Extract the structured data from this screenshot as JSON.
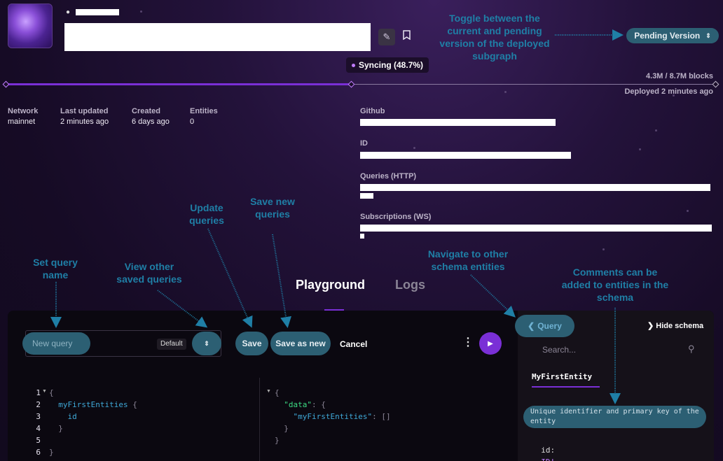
{
  "header": {
    "sync_status": "Syncing (48.7%)",
    "blocks": "4.3M / 8.7M blocks",
    "deployed": "Deployed 2 minutes ago",
    "version_select": "Pending Version",
    "progress": 0.487
  },
  "meta": {
    "network_label": "Network",
    "network_value": "mainnet",
    "updated_label": "Last updated",
    "updated_value": "2 minutes ago",
    "created_label": "Created",
    "created_value": "6 days ago",
    "entities_label": "Entities",
    "entities_value": "0"
  },
  "details": {
    "github_label": "Github",
    "id_label": "ID",
    "queries_label": "Queries (HTTP)",
    "subs_label": "Subscriptions (WS)"
  },
  "tabs": {
    "playground": "Playground",
    "logs": "Logs"
  },
  "toolbar": {
    "query_name_placeholder": "New query",
    "default_badge": "Default",
    "save": "Save",
    "save_as_new": "Save as new",
    "cancel": "Cancel"
  },
  "schema": {
    "back_label": "Query",
    "hide_label": "Hide schema",
    "search_placeholder": "Search...",
    "entity_tab": "MyFirstEntity",
    "comment": "Unique identifier and primary key of the entity",
    "field_name": "id:",
    "field_type": "ID!"
  },
  "editor": {
    "line_numbers": [
      "1",
      "2",
      "3",
      "4",
      "5",
      "6"
    ],
    "query_lines": [
      "{",
      "  myFirstEntities {",
      "    id",
      "  }",
      "",
      "}"
    ],
    "result_lines": [
      "{",
      "  \"data\": {",
      "    \"myFirstEntities\": []",
      "  }",
      "}"
    ]
  },
  "annotations": {
    "toggle": "Toggle between the current and pending version of the deployed subgraph",
    "set_name": "Set query name",
    "view_saved": "View other saved queries",
    "update": "Update queries",
    "save_new": "Save new queries",
    "navigate": "Navigate to other schema entities",
    "comments": "Comments can be added to entities in the schema"
  },
  "colors": {
    "accent": "#7a2fd6",
    "annotation": "#1f7fa6",
    "pill": "#2c5f73"
  }
}
